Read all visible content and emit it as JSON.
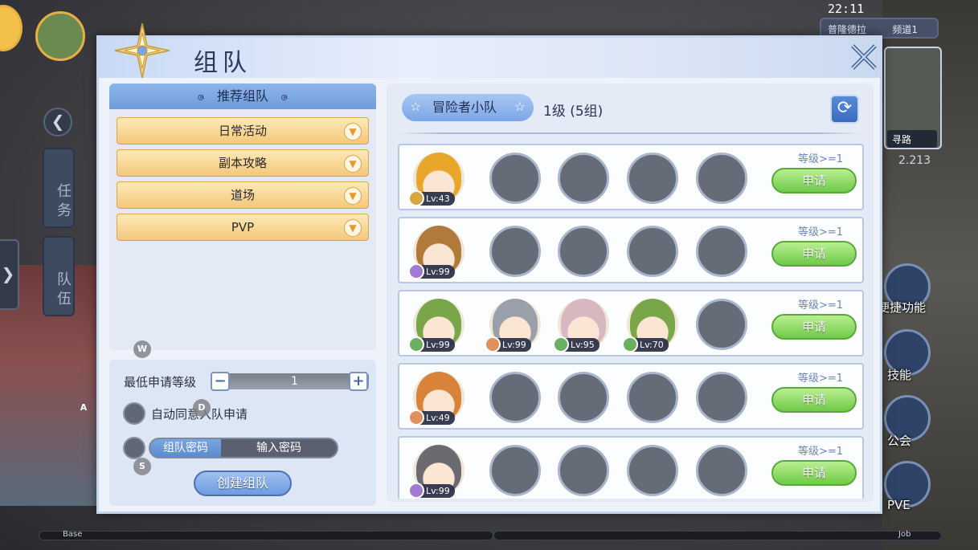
{
  "hud": {
    "time": "22:11",
    "location": "普隆德拉",
    "channel": "频道1",
    "coord": "2.213",
    "navigate": "寻路",
    "side_tabs": [
      "任务",
      "队伍"
    ],
    "skills": [
      "便捷功能",
      "技能",
      "公会",
      "PVE"
    ],
    "base_label": "Base",
    "job_label": "Job",
    "keys": {
      "w": "W",
      "a": "A",
      "s": "S",
      "d": "D"
    }
  },
  "dialog": {
    "title": "组队",
    "recommend_header": "推荐组队",
    "categories": [
      {
        "label": "日常活动"
      },
      {
        "label": "副本攻略"
      },
      {
        "label": "道场"
      },
      {
        "label": "PVP"
      }
    ],
    "min_level_label": "最低申请等级",
    "min_level_value": "1",
    "minus": "−",
    "plus": "+",
    "auto_accept_label": "自动同意入队申请",
    "password_label": "组队密码",
    "password_placeholder": "输入密码",
    "create_button": "创建组队",
    "team_tab": "冒险者小队",
    "level_info": "1级  (5组)",
    "apply_label": "申请",
    "requirement": "等级>=1"
  },
  "teams": [
    {
      "members": [
        {
          "lv": "Lv:43",
          "hair": "#e8a62a",
          "badge": "#d9a640"
        }
      ]
    },
    {
      "members": [
        {
          "lv": "Lv:99",
          "hair": "#b07a3a",
          "badge": "#a07ad0"
        }
      ]
    },
    {
      "members": [
        {
          "lv": "Lv:99",
          "hair": "#7aa64a",
          "badge": "#6ab060"
        },
        {
          "lv": "Lv:99",
          "hair": "#9aa0aa",
          "badge": "#e0905a"
        },
        {
          "lv": "Lv:95",
          "hair": "#d8b8c0",
          "badge": "#6ab060"
        },
        {
          "lv": "Lv:70",
          "hair": "#7aa64a",
          "badge": "#6ab060"
        }
      ]
    },
    {
      "members": [
        {
          "lv": "Lv:49",
          "hair": "#d8823a",
          "badge": "#e0905a"
        }
      ]
    },
    {
      "members": [
        {
          "lv": "Lv:99",
          "hair": "#6a6a70",
          "badge": "#a07ad0"
        }
      ]
    }
  ]
}
